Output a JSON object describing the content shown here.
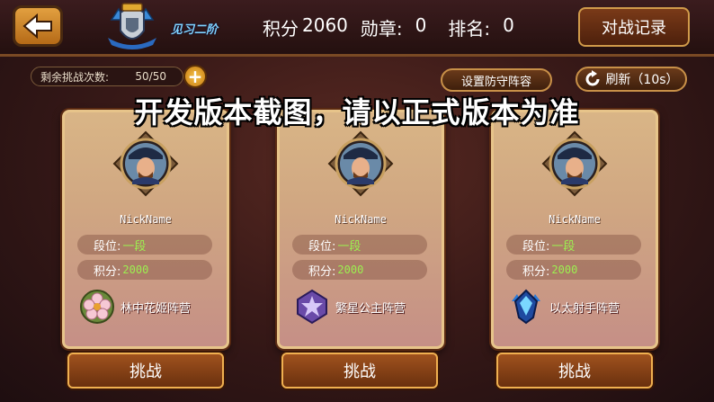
{
  "header": {
    "rank_name": "见习二阶",
    "score_label": "积分",
    "score_value": "2060",
    "medal_label": "勋章:",
    "medal_value": "0",
    "ranking_label": "排名:",
    "ranking_value": "0",
    "record_button": "对战记录"
  },
  "controls": {
    "challenges_label": "剩余挑战次数:",
    "challenges_value": "50/50",
    "add_symbol": "+",
    "defense_button": "设置防守阵容",
    "refresh_button": "刷新（10s）"
  },
  "notice": "开发版本截图，请以正式版本为准",
  "opponents": [
    {
      "nickname": "NickName",
      "rank_label": "段位:",
      "rank_value": "一段",
      "score_label": "积分:",
      "score_value": "2000",
      "camp": "林中花姬阵营",
      "camp_icon": "flower-icon",
      "button": "挑战"
    },
    {
      "nickname": "NickName",
      "rank_label": "段位:",
      "rank_value": "一段",
      "score_label": "积分:",
      "score_value": "2000",
      "camp": "繁星公主阵营",
      "camp_icon": "star-crest-icon",
      "button": "挑战"
    },
    {
      "nickname": "NickName",
      "rank_label": "段位:",
      "rank_value": "一段",
      "score_label": "积分:",
      "score_value": "2000",
      "camp": "以太射手阵营",
      "camp_icon": "crystal-crest-icon",
      "button": "挑战"
    }
  ],
  "colors": {
    "accent_gold": "#e7c48a",
    "rank_text_green": "#9cf050",
    "rank_name_blue": "#7fd4ff"
  }
}
